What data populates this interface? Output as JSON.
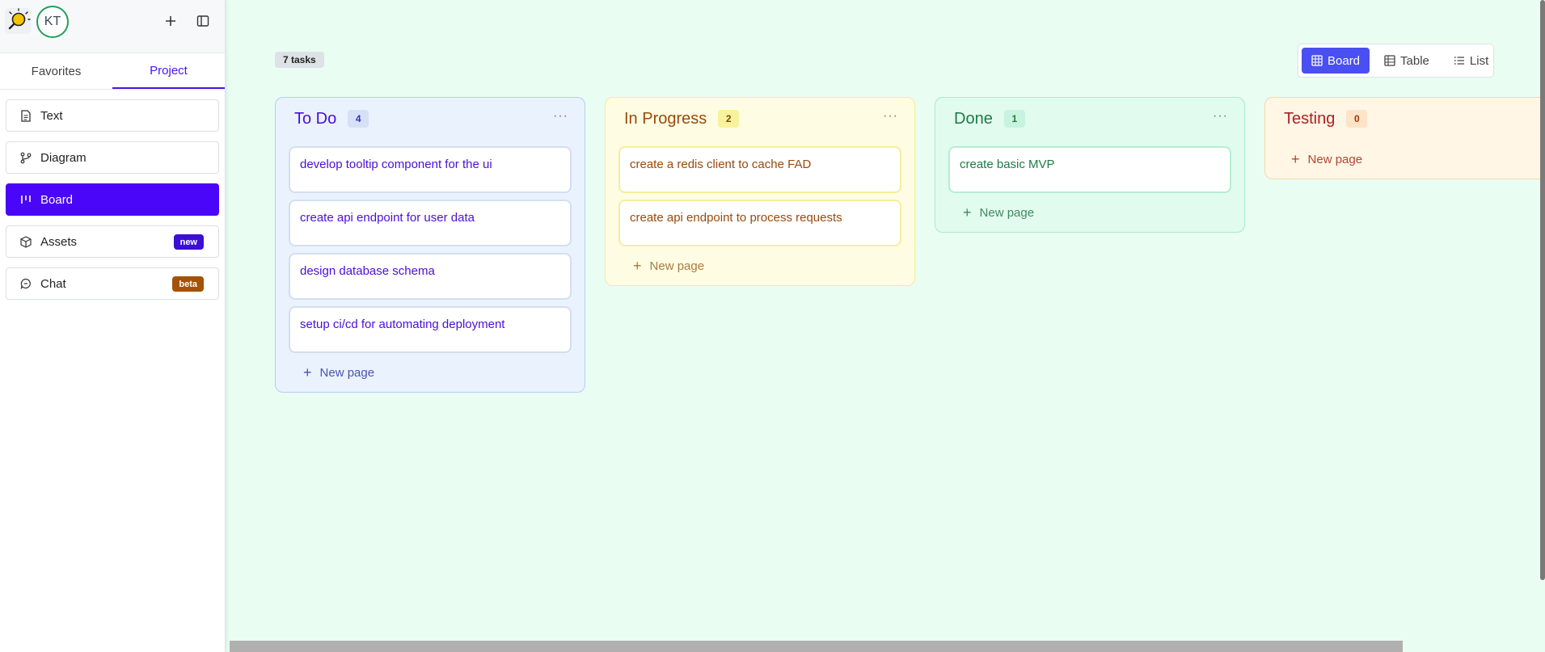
{
  "sidebar": {
    "avatar_initials": "KT",
    "tabs": [
      {
        "label": "Favorites",
        "active": false
      },
      {
        "label": "Project",
        "active": true
      }
    ],
    "items": [
      {
        "label": "Text",
        "icon": "document-icon",
        "active": false
      },
      {
        "label": "Diagram",
        "icon": "git-branch-icon",
        "active": false
      },
      {
        "label": "Board",
        "icon": "kanban-icon",
        "active": true
      },
      {
        "label": "Assets",
        "icon": "box-icon",
        "active": false,
        "badge": "new"
      },
      {
        "label": "Chat",
        "icon": "chat-icon",
        "active": false,
        "badge": "beta"
      }
    ]
  },
  "main": {
    "task_count": "7 tasks",
    "views": [
      {
        "label": "Board",
        "icon": "grid-icon",
        "active": true
      },
      {
        "label": "Table",
        "icon": "table-icon",
        "active": false
      },
      {
        "label": "List",
        "icon": "list-icon",
        "active": false
      }
    ],
    "columns": [
      {
        "title": "To Do",
        "count": "4",
        "cards": [
          "develop tooltip component for the ui",
          "create api endpoint for user data",
          "design database schema",
          "setup ci/cd for automating deployment"
        ],
        "new_page_label": "New page"
      },
      {
        "title": "In Progress",
        "count": "2",
        "cards": [
          "create a redis client to cache FAD",
          "create api endpoint to process requests"
        ],
        "new_page_label": "New page"
      },
      {
        "title": "Done",
        "count": "1",
        "cards": [
          "create basic MVP"
        ],
        "new_page_label": "New page"
      },
      {
        "title": "Testing",
        "count": "0",
        "cards": [],
        "new_page_label": "New page"
      }
    ]
  },
  "colors": {
    "accent": "#4a06f8",
    "board_bg": "#e9fdf2",
    "todo": "#4a0fd6",
    "in_progress": "#9a4a0a",
    "done": "#1e7a44",
    "testing": "#b01f1f"
  }
}
